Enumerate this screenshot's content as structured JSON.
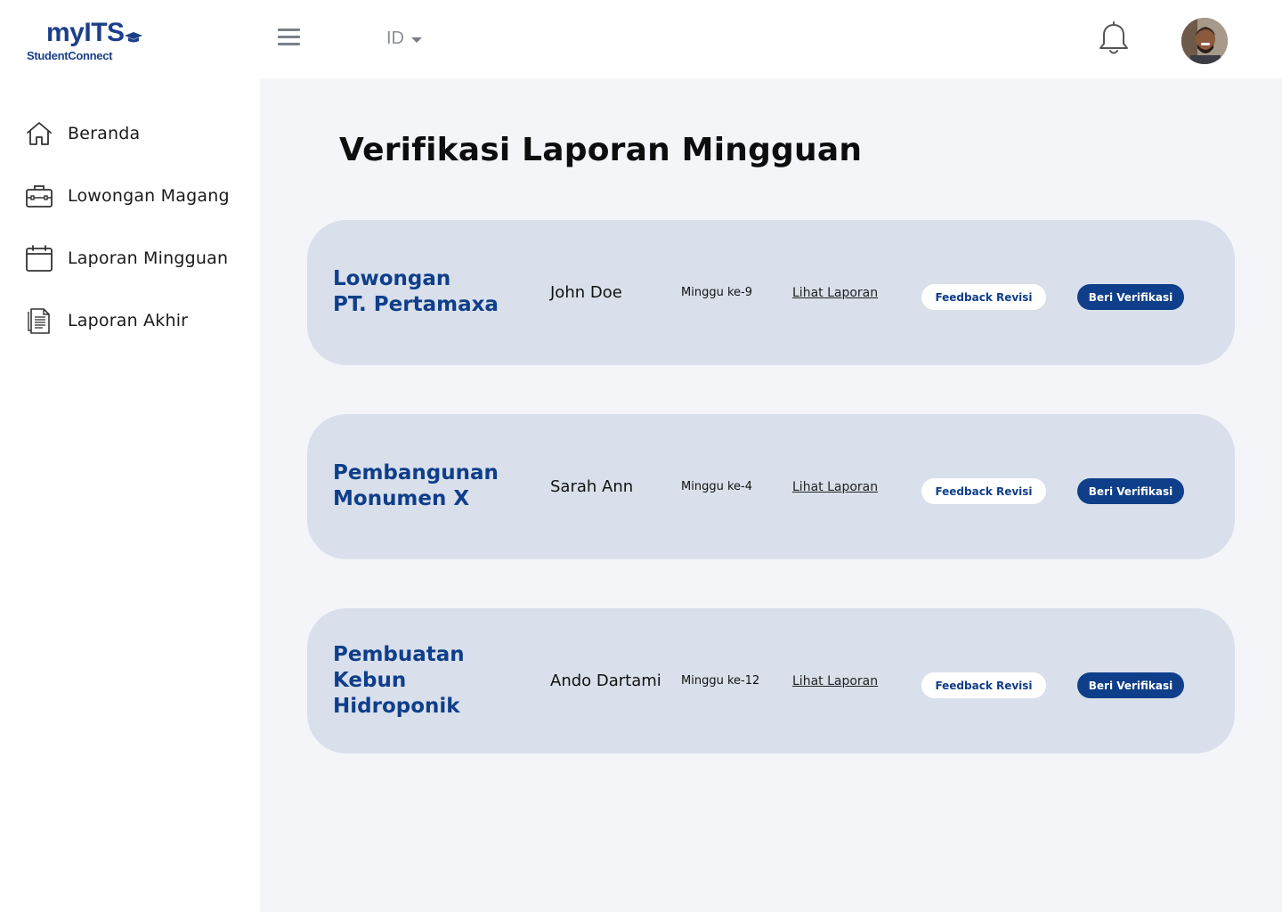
{
  "app": {
    "logo_main": "myITS",
    "logo_sub": "StudentConnect"
  },
  "header": {
    "language": "ID"
  },
  "sidebar": {
    "items": [
      {
        "label": "Beranda",
        "icon": "home-icon"
      },
      {
        "label": "Lowongan Magang",
        "icon": "briefcase-icon"
      },
      {
        "label": "Laporan Mingguan",
        "icon": "calendar-icon"
      },
      {
        "label": "Laporan Akhir",
        "icon": "document-icon"
      }
    ]
  },
  "main": {
    "title": "Verifikasi Laporan Mingguan",
    "reports": [
      {
        "title_lines": [
          "Lowongan",
          "PT. Pertamaxa"
        ],
        "name": "John Doe",
        "week": "Minggu ke-9",
        "link": "Lihat Laporan",
        "feedback": "Feedback Revisi",
        "verify": "Beri Verifikasi"
      },
      {
        "title_lines": [
          "Pembangunan",
          "Monumen X"
        ],
        "name": "Sarah Ann",
        "week": "Minggu ke-4",
        "link": "Lihat Laporan",
        "feedback": "Feedback Revisi",
        "verify": "Beri Verifikasi"
      },
      {
        "title_lines": [
          "Pembuatan",
          "Kebun",
          "Hidroponik"
        ],
        "name": "Ando Dartami",
        "week": "Minggu ke-12",
        "link": "Lihat Laporan",
        "feedback": "Feedback Revisi",
        "verify": "Beri Verifikasi"
      }
    ]
  },
  "colors": {
    "brand": "#0f3e8a",
    "card_bg": "#d9e0eb",
    "main_bg": "#f3f5f9"
  }
}
